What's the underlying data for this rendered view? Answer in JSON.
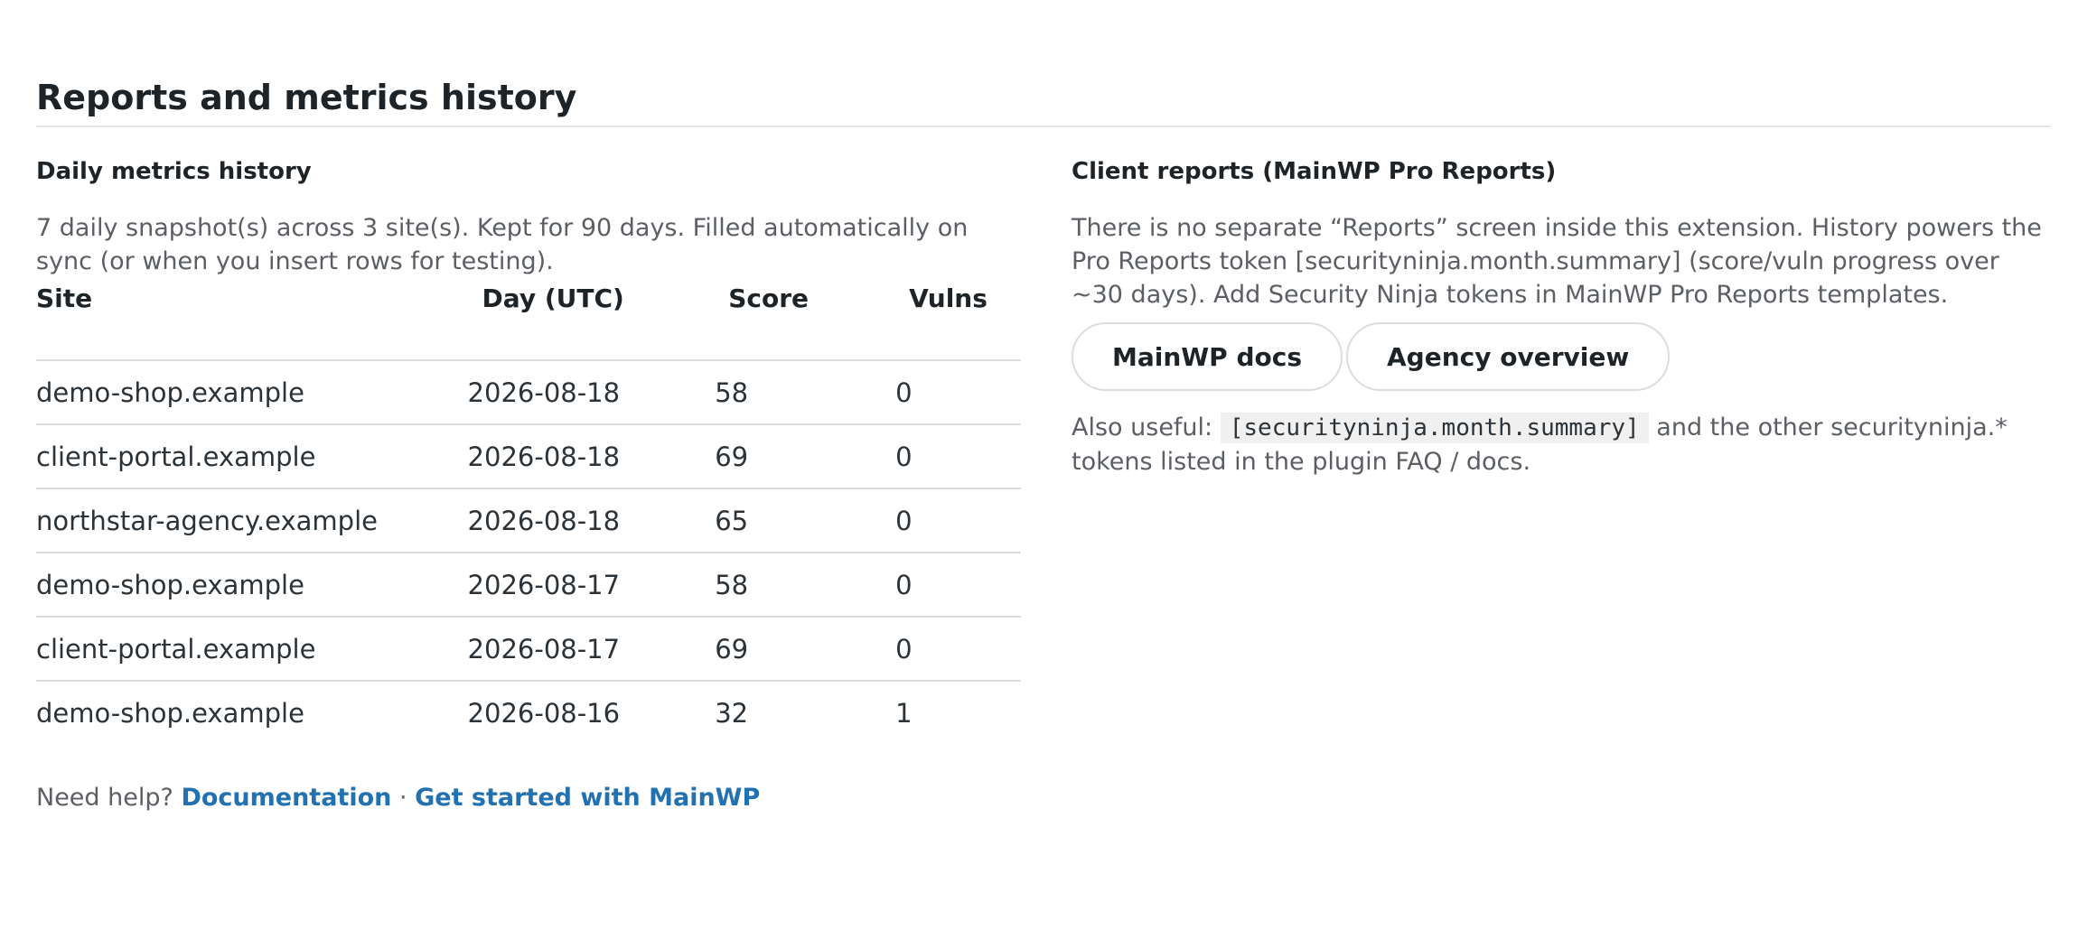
{
  "page": {
    "title": "Reports and metrics history"
  },
  "metrics": {
    "title": "Daily metrics history",
    "description": "7 daily snapshot(s) across 3 site(s). Kept for 90 days. Filled automatically on sync (or when you insert rows for testing).",
    "columns": [
      "Site",
      "Day (UTC)",
      "Score",
      "Vulns"
    ],
    "rows": [
      {
        "site": "demo-shop.example",
        "day": "2026-08-18",
        "score": "58",
        "vulns": "0"
      },
      {
        "site": "client-portal.example",
        "day": "2026-08-18",
        "score": "69",
        "vulns": "0"
      },
      {
        "site": "northstar-agency.example",
        "day": "2026-08-18",
        "score": "65",
        "vulns": "0"
      },
      {
        "site": "demo-shop.example",
        "day": "2026-08-17",
        "score": "58",
        "vulns": "0"
      },
      {
        "site": "client-portal.example",
        "day": "2026-08-17",
        "score": "69",
        "vulns": "0"
      },
      {
        "site": "demo-shop.example",
        "day": "2026-08-16",
        "score": "32",
        "vulns": "1"
      }
    ]
  },
  "help": {
    "prefix": "Need help?",
    "documentation_link": "Documentation",
    "separator": "·",
    "get_started_link": "Get started with MainWP"
  },
  "reports": {
    "title": "Client reports (MainWP Pro Reports)",
    "description": "There is no separate “Reports” screen inside this extension. History powers the Pro Reports token [securityninja.month.summary] (score/vuln progress over ~30 days). Add Security Ninja tokens in MainWP Pro Reports templates.",
    "buttons": {
      "docs": "MainWP docs",
      "agency": "Agency overview"
    },
    "also_prefix": "Also useful:",
    "token": "[securityninja.month.summary]",
    "also_suffix": "and the other securityninja.* tokens listed in the plugin FAQ / docs."
  },
  "colors": {
    "link": "#2271b1",
    "heading": "#1d2327",
    "muted_text": "#5b5f64",
    "border": "#dcdcde"
  }
}
